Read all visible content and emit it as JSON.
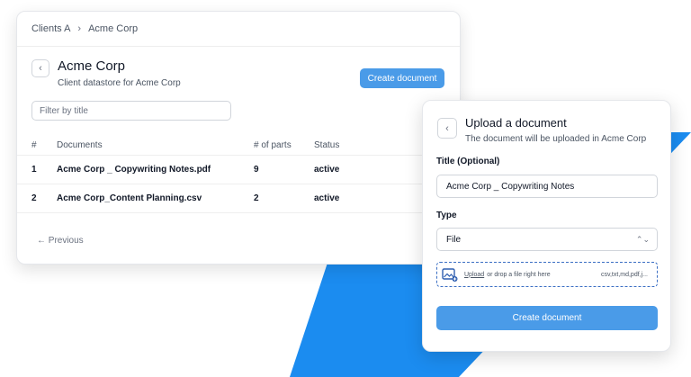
{
  "breadcrumb": {
    "parent": "Clients A",
    "current": "Acme Corp"
  },
  "header": {
    "title": "Acme Corp",
    "subtitle": "Client datastore for Acme Corp",
    "create_label": "Create document"
  },
  "filter": {
    "placeholder": "Filter by title"
  },
  "table": {
    "columns": [
      "#",
      "Documents",
      "# of parts",
      "Status"
    ],
    "rows": [
      {
        "num": "1",
        "name": "Acme Corp _ Copywriting Notes.pdf",
        "parts": "9",
        "status": "active"
      },
      {
        "num": "2",
        "name": "Acme Corp_Content Planning.csv",
        "parts": "2",
        "status": "active"
      }
    ]
  },
  "pagination": {
    "previous_label": "← Previous"
  },
  "modal": {
    "title": "Upload a document",
    "subtitle": "The document will be uploaded in Acme Corp",
    "title_label": "Title (Optional)",
    "title_value": "Acme Corp _ Copywriting Notes",
    "type_label": "Type",
    "type_value": "File",
    "upload_link": "Upload",
    "drop_text": "or drop a file right here",
    "file_types": "csv,txt,md,pdf,j...",
    "submit_label": "Create document"
  },
  "colors": {
    "accent": "#4a9be8",
    "decor": "#1b8cf0"
  },
  "icons": {
    "back": "chevron-left-icon",
    "select": "select-arrows-icon",
    "upload": "image-upload-icon",
    "arrow": "arrow-left-icon"
  }
}
